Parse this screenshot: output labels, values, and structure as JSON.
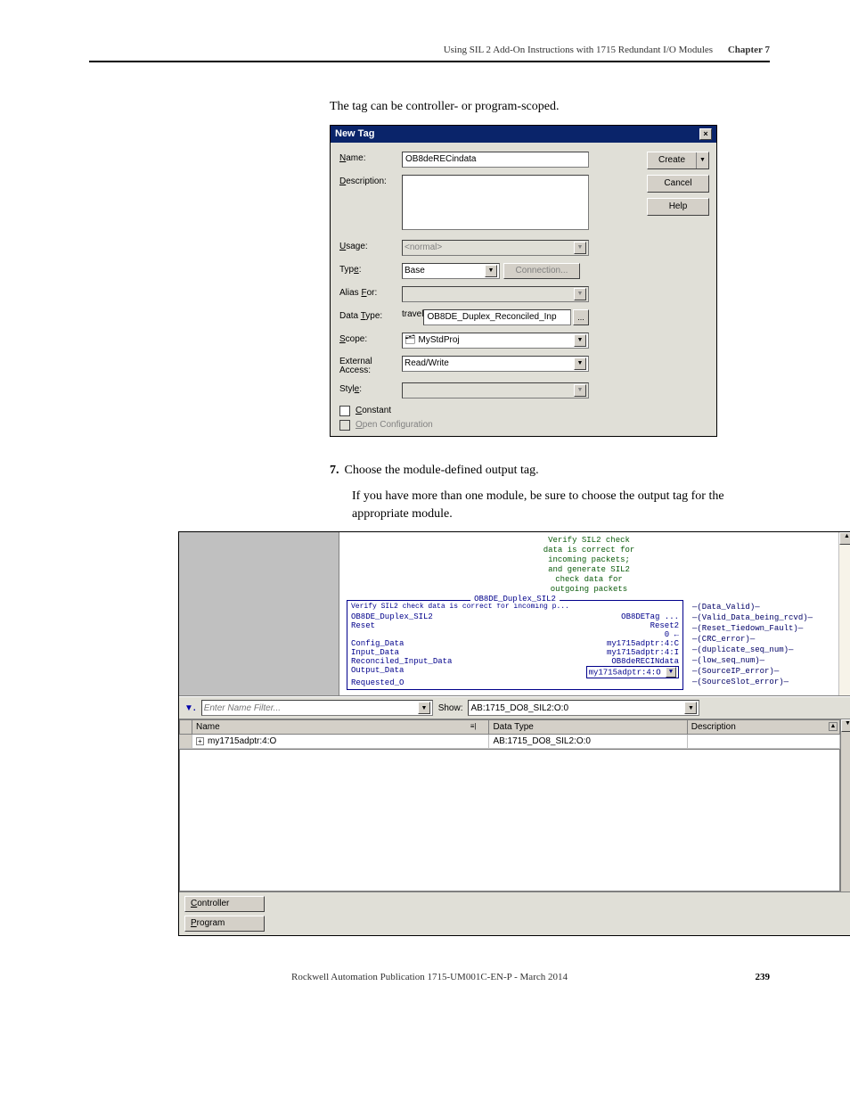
{
  "header": {
    "section_title": "Using SIL 2 Add-On Instructions with 1715 Redundant I/O Modules",
    "chapter": "Chapter 7"
  },
  "intro_text": "The tag can be controller- or program-scoped.",
  "dialog": {
    "title": "New Tag",
    "labels": {
      "name": "Name:",
      "description": "Description:",
      "usage": "Usage:",
      "type": "Type:",
      "alias_for": "Alias For:",
      "data_type": "Data Type:",
      "scope": "Scope:",
      "external_access": "External Access:",
      "style": "Style:",
      "constant": "Constant",
      "open_config": "Open Configuration"
    },
    "values": {
      "name": "OB8deRECindata",
      "usage": "<normal>",
      "type": "Base",
      "connection_btn": "Connection...",
      "data_type": "OB8DE_Duplex_Reconciled_Inp",
      "scope": "MyStdProj",
      "external_access": "Read/Write"
    },
    "buttons": {
      "create": "Create",
      "cancel": "Cancel",
      "help": "Help"
    }
  },
  "step7": {
    "num": "7.",
    "text": "Choose the module-defined output tag.",
    "followup": "If you have more than one module, be sure to choose the output tag for the appropriate module."
  },
  "ladder": {
    "comment_lines": [
      "Verify SIL2 check",
      "data is correct for",
      "incoming packets;",
      "and generate SIL2",
      "check data for",
      "outgoing packets"
    ],
    "block_title": "OB8DE_Duplex_SIL2",
    "block_subtitle": "Verify SIL2 check data is correct for incoming p...",
    "rows": [
      {
        "l": "OB8DE_Duplex_SIL2",
        "r": "OB8DETag"
      },
      {
        "l": "Reset",
        "r": "Reset2"
      },
      {
        "l": "",
        "r": "0"
      },
      {
        "l": "Config_Data",
        "r": "my1715adptr:4:C"
      },
      {
        "l": "Input_Data",
        "r": "my1715adptr:4:I"
      },
      {
        "l": "Reconciled_Input_Data",
        "r": "OB8deRECINdata"
      },
      {
        "l": "Output_Data",
        "r": "my1715adptr:4:O"
      },
      {
        "l": "Requested_O",
        "r": ""
      }
    ],
    "coils": [
      "(Data_Valid)",
      "(Valid_Data_being_rcvd)",
      "(Reset_Tiedown_Fault)",
      "(CRC_error)",
      "(duplicate_seq_num)",
      "(low_seq_num)",
      "(SourceIP_error)",
      "(SourceSlot_error)"
    ],
    "filter_placeholder": "Enter Name Filter...",
    "show_label": "Show:",
    "show_value": "AB:1715_DO8_SIL2:O:0",
    "columns": {
      "name": "Name",
      "data_type": "Data Type",
      "description": "Description"
    },
    "row": {
      "name": "my1715adptr:4:O",
      "data_type": "AB:1715_DO8_SIL2:O:0",
      "description": ""
    },
    "tabs": {
      "controller": "Controller",
      "program": "Program"
    }
  },
  "footer": {
    "publication": "Rockwell Automation Publication 1715-UM001C-EN-P - March 2014",
    "page": "239"
  }
}
